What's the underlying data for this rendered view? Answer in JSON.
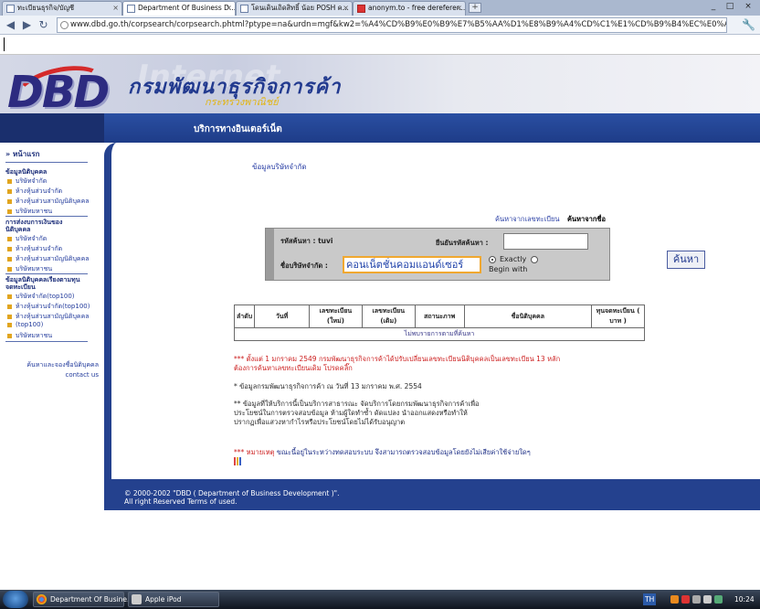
{
  "browser": {
    "tabs": [
      {
        "label": "ทะเบียนธุรกิจ/บัญชี"
      },
      {
        "label": "Department Of Business D..."
      },
      {
        "label": "โดนเดินเถิดสิทธิ์ น้อย POSH ค..."
      },
      {
        "label": "anonym.to - free dereferer..."
      }
    ],
    "url": "www.dbd.go.th/corpsearch/corpsearch.phtml?ptype=na&urdn=mgf&kw2=%A4%CD%B9%E0%B9%E7%B5%AA%D1%E8%B9%A4%CD%C1%E1%CD%B9%B4%EC%E0%AB"
  },
  "header": {
    "logo": "DBD",
    "ghost": "Internet",
    "title": "กรมพัฒนาธุรกิจการค้า",
    "subtitle": "กระทรวงพาณิชย์",
    "band_title": "บริการทางอินเตอร์เน็ต"
  },
  "sidebar": {
    "home": "หน้าแรก",
    "group1": "ข้อมูลนิติบุคคล",
    "group1_items": [
      "บริษัทจำกัด",
      "ห้างหุ้นส่วนจำกัด",
      "ห้างหุ้นส่วนสามัญนิติบุคคล",
      "บริษัทมหาชน"
    ],
    "group2a": "การส่งงบการเงินของ",
    "group2b": "นิติบุคคล",
    "group2_items": [
      "บริษัทจำกัด",
      "ห้างหุ้นส่วนจำกัด",
      "ห้างหุ้นส่วนสามัญนิติบุคคล",
      "บริษัทมหาชน"
    ],
    "group3a": "ข้อมูลนิติบุคคลเรียงตามทุน",
    "group3b": "จดทะเบียน",
    "group3_items": [
      "บริษัทจำกัด(top100)",
      "ห้างหุ้นส่วนจำกัด(top100)",
      "ห้างหุ้นส่วนสามัญนิติบุคคล",
      "(top100)",
      "บริษัทมหาชน"
    ],
    "contact1": "ค้นหาและจองชื่อนิติบุคคล",
    "contact2": "contact us"
  },
  "main": {
    "company_link": "ข้อมูลบริษัทจำกัด",
    "tab_inactive": "ค้นหาจากเลขทะเบียน",
    "tab_active": "ค้นหาจากชื่อ",
    "regno_label": "รหัสค้นหา : tuvi",
    "regno_label2": "ยืนยันรหัสค้นหา :",
    "name_label": "ชื่อบริษัทจำกัด :",
    "name_value": "คอนเน็ตชั่นคอมแอนด์เซอร์",
    "radio_exact": "Exactly",
    "radio_begin": "Begin with",
    "search_button": "ค้นหา",
    "table": {
      "headers": [
        "ลำดับ",
        "วันที่",
        "เลขทะเบียน (ใหม่)",
        "เลขทะเบียน (เดิม)",
        "สถานะภาพ",
        "ชื่อนิติบุคคล",
        "ทุนจดทะเบียน ( บาท )"
      ],
      "empty": "ไม่พบรายการตามที่ค้นหา"
    },
    "note1_a": "*** ตั้งแต่ 1 มกราคม 2549 กรมพัฒนาธุรกิจการค้าได้ปรับเปลี่ยนเลขทะเบียนนิติบุคคลเป็นเลขทะเบียน 13 หลัก",
    "note1_b": "ต้องการค้นหาเลขทะเบียนเดิม โปรดคลิ๊ก",
    "note2": "* ข้อมูลกรมพัฒนาธุรกิจการค้า ณ วันที่ 13 มกราคม พ.ศ. 2554",
    "note3_a": "** ข้อมูลที่ให้บริการนี้เป็นบริการสาธารณะ จัดบริการโดยกรมพัฒนาธุรกิจการค้าเพื่อ",
    "note3_b": "ประโยชน์ในการตรวจสอบข้อมูล ห้ามผู้ใดทำซ้ำ ดัดแปลง นำออกแสดงหรือทำให้",
    "note3_c": "ปรากฏเพื่อแสวงหากำไรหรือประโยชน์โดยไม่ได้รับอนุญาต",
    "note4_prefix": "*** หมายเหตุ",
    "note4_text": "ขณะนี้อยู่ในระหว่างทดสอบระบบ จึงสามารถตรวจสอบข้อมูลโดยยังไม่เสียค่าใช้จ่ายใดๆ"
  },
  "footer": {
    "line1": "© 2000-2002 \"DBD ( Department of Business Development )\".",
    "line2": "All right Reserved Terms of used."
  },
  "taskbar": {
    "items": [
      "Department Of Busine...",
      "Apple iPod"
    ],
    "lang": "TH",
    "clock": "10:24"
  }
}
